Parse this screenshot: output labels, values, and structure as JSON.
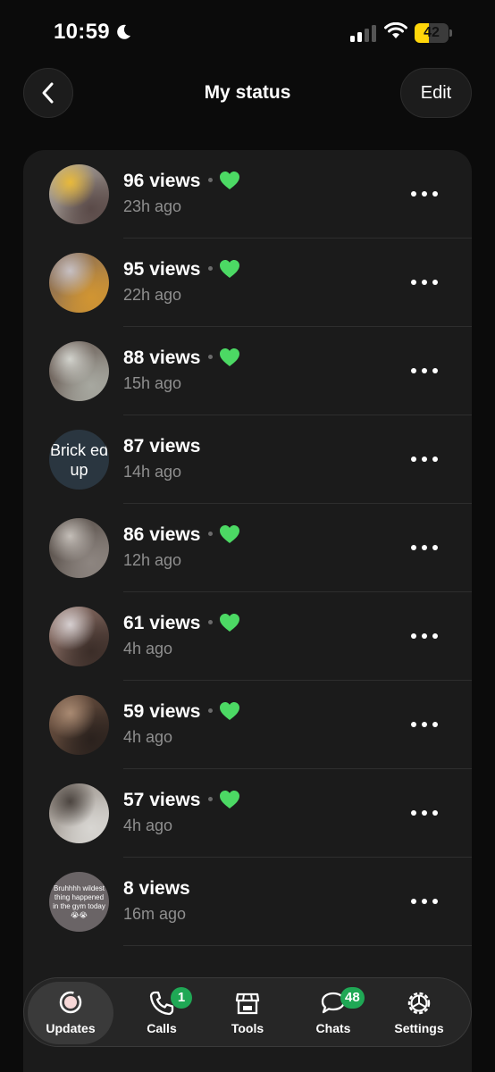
{
  "status_bar": {
    "time": "10:59",
    "moon_icon": "moon-icon",
    "signal_icon": "cellular-signal-icon",
    "wifi_icon": "wifi-icon",
    "battery_level": "42",
    "battery_color": "#ffd60a"
  },
  "header": {
    "back_icon": "chevron-left-icon",
    "title": "My status",
    "edit_label": "Edit"
  },
  "statuses": [
    {
      "views": "96 views",
      "liked": true,
      "age": "23h ago",
      "thumb_colors": [
        "#5a4a48",
        "#b9b4ad",
        "#e8b93a"
      ]
    },
    {
      "views": "95 views",
      "liked": true,
      "age": "22h ago",
      "thumb_colors": [
        "#d19532",
        "#7a655c",
        "#c7c0c3"
      ]
    },
    {
      "views": "88 views",
      "liked": true,
      "age": "15h ago",
      "thumb_colors": [
        "#a7a8a0",
        "#5a4a43",
        "#d2d3cd"
      ]
    },
    {
      "views": "87 views",
      "liked": false,
      "age": "14h ago",
      "thumb_text": "Brick ed up"
    },
    {
      "views": "86 views",
      "liked": true,
      "age": "12h ago",
      "thumb_colors": [
        "#8d8580",
        "#4b423c",
        "#c4beb8"
      ]
    },
    {
      "views": "61 views",
      "liked": true,
      "age": "4h ago",
      "thumb_colors": [
        "#3b2d28",
        "#9a7c72",
        "#d6cfd0"
      ]
    },
    {
      "views": "59 views",
      "liked": true,
      "age": "4h ago",
      "thumb_colors": [
        "#2a211d",
        "#7a5c49",
        "#a98a72"
      ]
    },
    {
      "views": "57 views",
      "liked": true,
      "age": "4h ago",
      "thumb_colors": [
        "#d8d6d2",
        "#8f867e",
        "#4c4540"
      ]
    },
    {
      "views": "8 views",
      "liked": false,
      "age": "16m ago",
      "thumb_text": "Bruhhhh wildest thing happened in the gym today 😭😭"
    }
  ],
  "heart_color": "#4cd964",
  "tab_bar": {
    "tabs": [
      {
        "label": "Updates",
        "icon": "updates-icon",
        "active": true,
        "badge": ""
      },
      {
        "label": "Calls",
        "icon": "phone-icon",
        "active": false,
        "badge": "1"
      },
      {
        "label": "Tools",
        "icon": "storefront-icon",
        "active": false,
        "badge": ""
      },
      {
        "label": "Chats",
        "icon": "chat-bubbles-icon",
        "active": false,
        "badge": "48"
      },
      {
        "label": "Settings",
        "icon": "gear-icon",
        "active": false,
        "badge": ""
      }
    ],
    "badge_color": "#1fa855"
  }
}
